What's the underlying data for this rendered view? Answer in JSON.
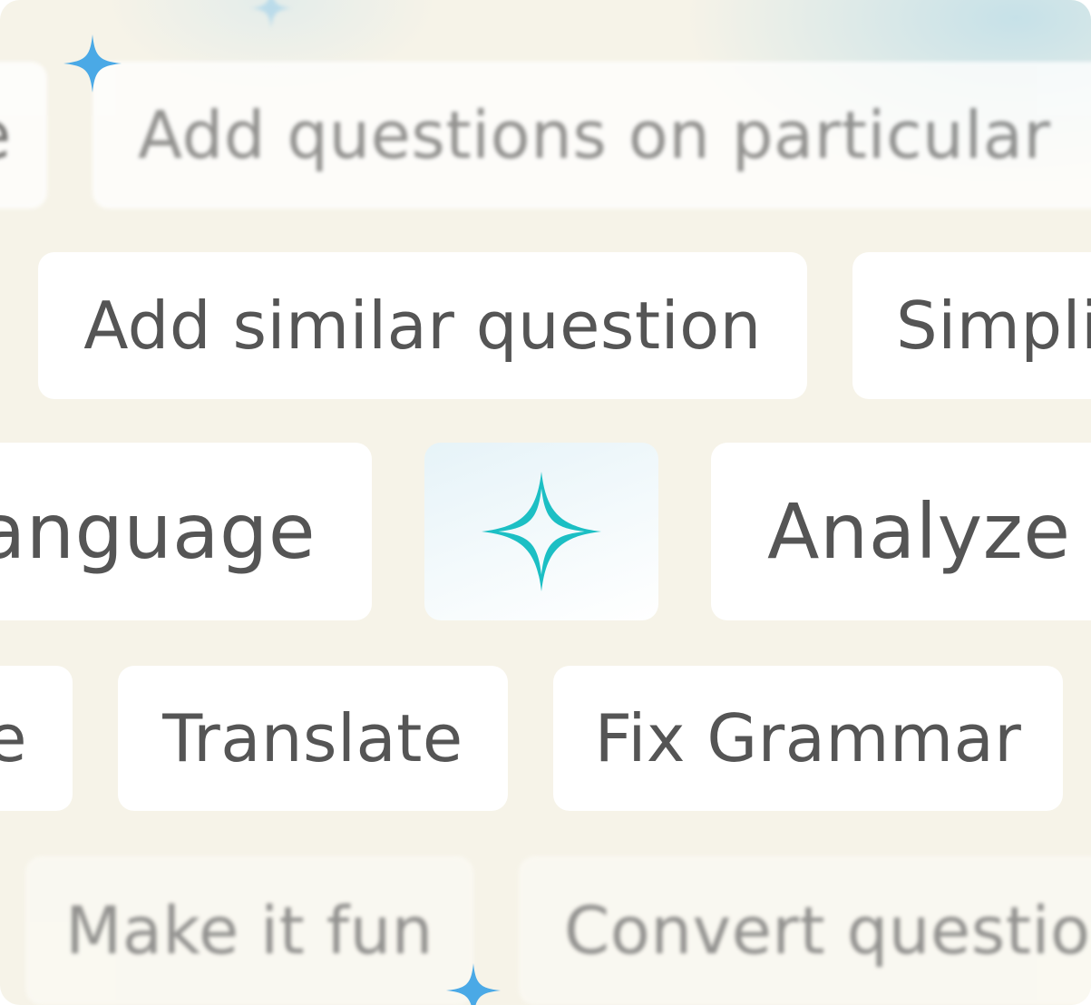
{
  "chips": {
    "top_left": "e",
    "add_particular": "Add questions on particular",
    "add_similar": "Add similar question",
    "simplify": "Simpli",
    "language": "anguage",
    "analyze": "Analyze",
    "left_e": "e",
    "translate": "Translate",
    "fix_grammar": "Fix Grammar",
    "make_fun": "Make it fun",
    "convert": "Convert questio"
  },
  "icons": {
    "ai_button": "ai-sparkle-icon",
    "decor_top": "sparkle-icon",
    "decor_bottom": "sparkle-icon"
  },
  "colors": {
    "background": "#f6f3e8",
    "chip": "#ffffff",
    "text": "#555555",
    "ai_accent": "#1cbfc4",
    "sparkle": "#4aa9e6"
  }
}
